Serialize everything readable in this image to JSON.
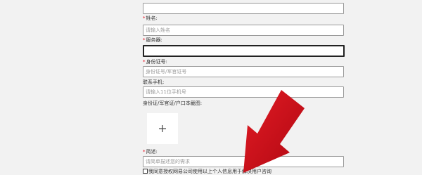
{
  "form": {
    "name": {
      "label": "姓名:",
      "required_mark": "*",
      "placeholder": "请输入姓名"
    },
    "server": {
      "label": "服务器:",
      "required_mark": "*",
      "value": ""
    },
    "id_number": {
      "label": "身份证号:",
      "required_mark": "*",
      "placeholder": "身份证号/军官证号"
    },
    "phone": {
      "label": "联系手机:",
      "placeholder": "请输入11位手机号"
    },
    "photo": {
      "label": "身份证/军官证/户口本截图:",
      "upload_icon": "plus-icon"
    },
    "description": {
      "label": "简述:",
      "required_mark": "*",
      "placeholder": "请简单描述您的需求"
    },
    "agreement": {
      "text": "我同意授权网易公司使用以上个人信息用于解决用户咨询"
    }
  },
  "annotation": {
    "icon": "red-arrow-icon",
    "color": "#d0101c"
  }
}
